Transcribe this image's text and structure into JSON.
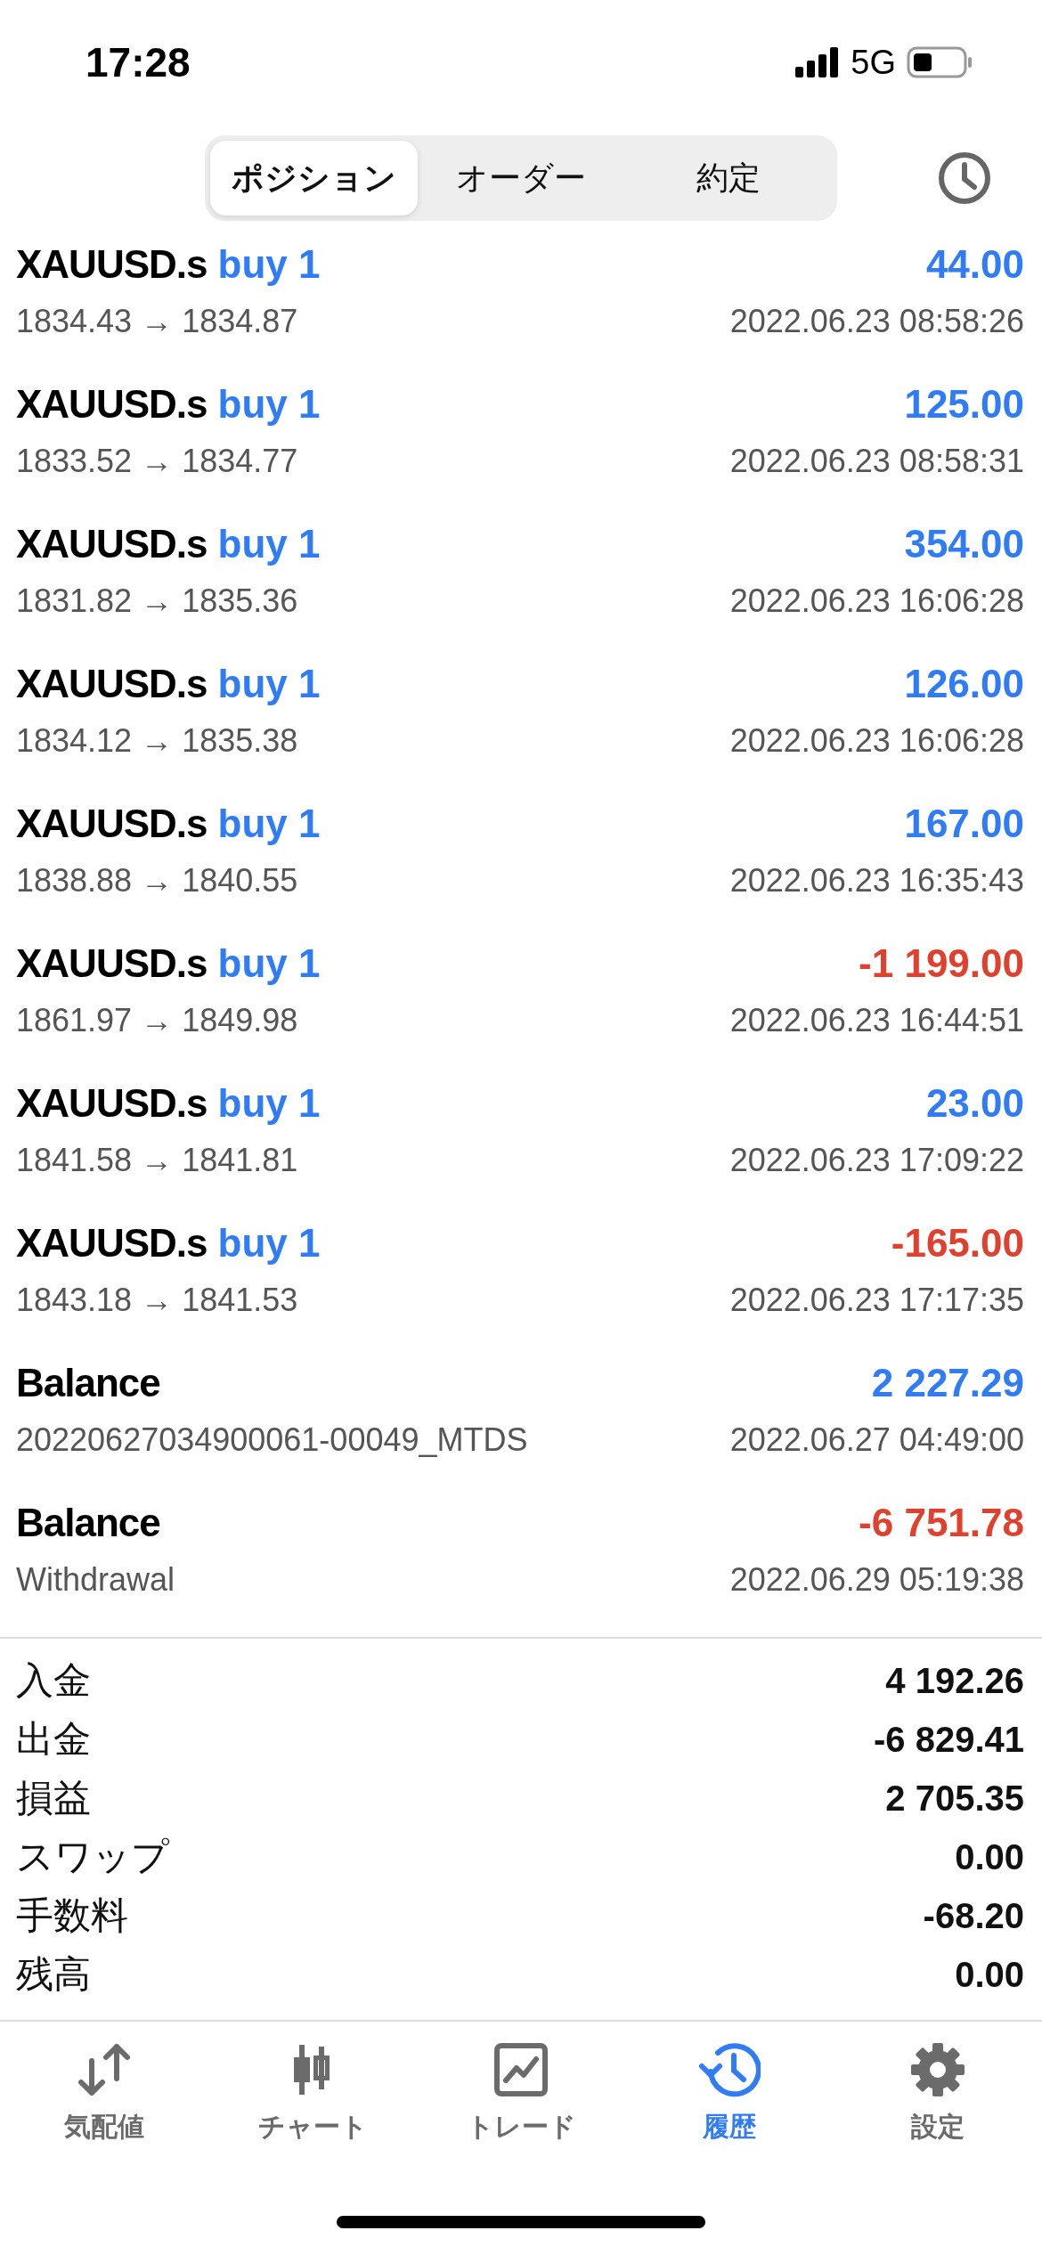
{
  "status_bar": {
    "time": "17:28",
    "network": "5G"
  },
  "segments": [
    {
      "label": "ポジション",
      "selected": true
    },
    {
      "label": "オーダー",
      "selected": false
    },
    {
      "label": "約定",
      "selected": false
    }
  ],
  "deals": [
    {
      "symbol": "XAUUSD.s",
      "action": "buy 1",
      "prices": "1834.43 → 1834.87",
      "amount": "44.00",
      "color": "#2f7cf6",
      "time": "2022.06.23 08:58:26"
    },
    {
      "symbol": "XAUUSD.s",
      "action": "buy 1",
      "prices": "1833.52 → 1834.77",
      "amount": "125.00",
      "color": "#2f7cf6",
      "time": "2022.06.23 08:58:31"
    },
    {
      "symbol": "XAUUSD.s",
      "action": "buy 1",
      "prices": "1831.82 → 1835.36",
      "amount": "354.00",
      "color": "#2f7cf6",
      "time": "2022.06.23 16:06:28"
    },
    {
      "symbol": "XAUUSD.s",
      "action": "buy 1",
      "prices": "1834.12 → 1835.38",
      "amount": "126.00",
      "color": "#2f7cf6",
      "time": "2022.06.23 16:06:28"
    },
    {
      "symbol": "XAUUSD.s",
      "action": "buy 1",
      "prices": "1838.88 → 1840.55",
      "amount": "167.00",
      "color": "#2f7cf6",
      "time": "2022.06.23 16:35:43"
    },
    {
      "symbol": "XAUUSD.s",
      "action": "buy 1",
      "prices": "1861.97 → 1849.98",
      "amount": "-1 199.00",
      "color": "#e0412f",
      "time": "2022.06.23 16:44:51"
    },
    {
      "symbol": "XAUUSD.s",
      "action": "buy 1",
      "prices": "1841.58 → 1841.81",
      "amount": "23.00",
      "color": "#2f7cf6",
      "time": "2022.06.23 17:09:22"
    },
    {
      "symbol": "XAUUSD.s",
      "action": "buy 1",
      "prices": "1843.18 → 1841.53",
      "amount": "-165.00",
      "color": "#e0412f",
      "time": "2022.06.23 17:17:35"
    },
    {
      "symbol": "Balance",
      "prices": "20220627034900061-00049_MTDS",
      "amount": "2 227.29",
      "color": "#2f7cf6",
      "time": "2022.06.27 04:49:00"
    },
    {
      "symbol": "Balance",
      "prices": "Withdrawal",
      "amount": "-6 751.78",
      "color": "#e0412f",
      "time": "2022.06.29 05:19:38"
    }
  ],
  "summary": [
    {
      "label": "入金",
      "value": "4 192.26"
    },
    {
      "label": "出金",
      "value": "-6 829.41"
    },
    {
      "label": "損益",
      "value": "2 705.35"
    },
    {
      "label": "スワップ",
      "value": "0.00"
    },
    {
      "label": "手数料",
      "value": "-68.20"
    },
    {
      "label": "残高",
      "value": "0.00"
    }
  ],
  "tab_bar": [
    {
      "kind": "quotes",
      "label": "気配値",
      "selected": false
    },
    {
      "kind": "chart",
      "label": "チャート",
      "selected": false
    },
    {
      "kind": "trade",
      "label": "トレード",
      "selected": false
    },
    {
      "kind": "history",
      "label": "履歴",
      "selected": true
    },
    {
      "kind": "settings",
      "label": "設定",
      "selected": false
    }
  ]
}
